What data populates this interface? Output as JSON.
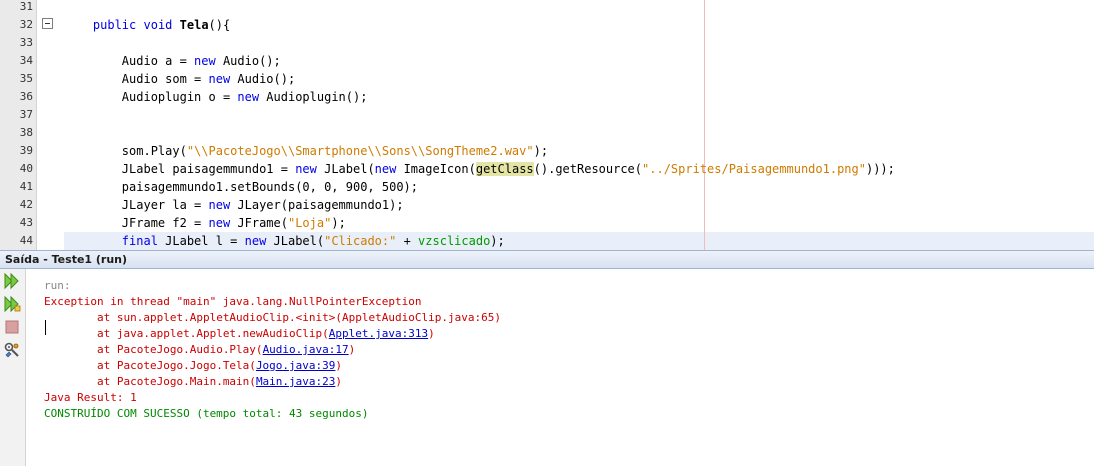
{
  "editor": {
    "lines": [
      {
        "num": "31",
        "segments": []
      },
      {
        "num": "32",
        "segments": [
          {
            "t": "    ",
            "c": ""
          },
          {
            "t": "public",
            "c": "kw"
          },
          {
            "t": " ",
            "c": ""
          },
          {
            "t": "void",
            "c": "kw"
          },
          {
            "t": " ",
            "c": ""
          },
          {
            "t": "Tela",
            "c": "fn-bold"
          },
          {
            "t": "(){",
            "c": ""
          }
        ]
      },
      {
        "num": "33",
        "segments": []
      },
      {
        "num": "34",
        "segments": [
          {
            "t": "        Audio a = ",
            "c": ""
          },
          {
            "t": "new",
            "c": "kw"
          },
          {
            "t": " Audio();",
            "c": ""
          }
        ]
      },
      {
        "num": "35",
        "segments": [
          {
            "t": "        Audio som = ",
            "c": ""
          },
          {
            "t": "new",
            "c": "kw"
          },
          {
            "t": " Audio();",
            "c": ""
          }
        ]
      },
      {
        "num": "36",
        "segments": [
          {
            "t": "        Audioplugin o = ",
            "c": ""
          },
          {
            "t": "new",
            "c": "kw"
          },
          {
            "t": " Audioplugin();",
            "c": ""
          }
        ]
      },
      {
        "num": "37",
        "segments": []
      },
      {
        "num": "38",
        "segments": []
      },
      {
        "num": "39",
        "segments": [
          {
            "t": "        som.Play(",
            "c": ""
          },
          {
            "t": "\"\\\\PacoteJogo\\\\Smartphone\\\\Sons\\\\SongTheme2.wav\"",
            "c": "str"
          },
          {
            "t": ");",
            "c": ""
          }
        ]
      },
      {
        "num": "40",
        "segments": [
          {
            "t": "        JLabel paisagemmundo1 = ",
            "c": ""
          },
          {
            "t": "new",
            "c": "kw"
          },
          {
            "t": " JLabel(",
            "c": ""
          },
          {
            "t": "new",
            "c": "kw"
          },
          {
            "t": " ImageIcon(",
            "c": ""
          },
          {
            "t": "getClass",
            "c": "hl"
          },
          {
            "t": "().getResource(",
            "c": ""
          },
          {
            "t": "\"../Sprites/Paisagemmundo1.png\"",
            "c": "str"
          },
          {
            "t": ")));",
            "c": ""
          }
        ]
      },
      {
        "num": "41",
        "segments": [
          {
            "t": "        paisagemmundo1.setBounds(0, 0, 900, 500);",
            "c": ""
          }
        ]
      },
      {
        "num": "42",
        "segments": [
          {
            "t": "        JLayer la = ",
            "c": ""
          },
          {
            "t": "new",
            "c": "kw"
          },
          {
            "t": " JLayer(paisagemmundo1);",
            "c": ""
          }
        ]
      },
      {
        "num": "43",
        "segments": [
          {
            "t": "        JFrame f2 = ",
            "c": ""
          },
          {
            "t": "new",
            "c": "kw"
          },
          {
            "t": " JFrame(",
            "c": ""
          },
          {
            "t": "\"Loja\"",
            "c": "str"
          },
          {
            "t": ");",
            "c": ""
          }
        ]
      },
      {
        "num": "44",
        "segments": [
          {
            "t": "        ",
            "c": ""
          },
          {
            "t": "final",
            "c": "kw"
          },
          {
            "t": " JLabel l = ",
            "c": ""
          },
          {
            "t": "new",
            "c": "kw"
          },
          {
            "t": " JLabel(",
            "c": ""
          },
          {
            "t": "\"Clicado:\"",
            "c": "str"
          },
          {
            "t": " + ",
            "c": ""
          },
          {
            "t": "vzsclicado",
            "c": "ident"
          },
          {
            "t": ");",
            "c": ""
          }
        ]
      }
    ]
  },
  "output": {
    "title": "Saída - Teste1 (run)",
    "toolbar_icons": [
      "rerun-icon",
      "rerun-with-options-icon",
      "stop-icon",
      "settings-icon"
    ],
    "lines": [
      {
        "indent": "",
        "segments": [
          {
            "t": "run:",
            "c": "gray"
          }
        ]
      },
      {
        "indent": "",
        "segments": [
          {
            "t": "Exception in thread \"main\" java.lang.NullPointerException",
            "c": "red"
          }
        ]
      },
      {
        "indent": "        ",
        "segments": [
          {
            "t": "at sun.applet.AppletAudioClip.<init>(AppletAudioClip.java:65)",
            "c": "red"
          }
        ]
      },
      {
        "indent": "        ",
        "segments": [
          {
            "t": "at java.applet.Applet.newAudioClip(",
            "c": "red"
          },
          {
            "t": "Applet.java:313",
            "c": "link"
          },
          {
            "t": ")",
            "c": "red"
          }
        ]
      },
      {
        "indent": "        ",
        "segments": [
          {
            "t": "at PacoteJogo.Audio.Play(",
            "c": "red"
          },
          {
            "t": "Audio.java:17",
            "c": "link"
          },
          {
            "t": ")",
            "c": "red"
          }
        ]
      },
      {
        "indent": "        ",
        "segments": [
          {
            "t": "at PacoteJogo.Jogo.Tela(",
            "c": "red"
          },
          {
            "t": "Jogo.java:39",
            "c": "link"
          },
          {
            "t": ")",
            "c": "red"
          }
        ]
      },
      {
        "indent": "        ",
        "segments": [
          {
            "t": "at PacoteJogo.Main.main(",
            "c": "red"
          },
          {
            "t": "Main.java:23",
            "c": "link"
          },
          {
            "t": ")",
            "c": "red"
          }
        ]
      },
      {
        "indent": "",
        "segments": [
          {
            "t": "Java Result: 1",
            "c": "red"
          }
        ]
      },
      {
        "indent": "",
        "segments": [
          {
            "t": "CONSTRUÍDO COM SUCESSO (tempo total: 43 segundos)",
            "c": "green"
          }
        ]
      }
    ]
  },
  "colors": {
    "keyword": "#0000e6",
    "string": "#ce7b00",
    "error": "#cc0000",
    "success": "#008800",
    "link": "#0000cc"
  }
}
